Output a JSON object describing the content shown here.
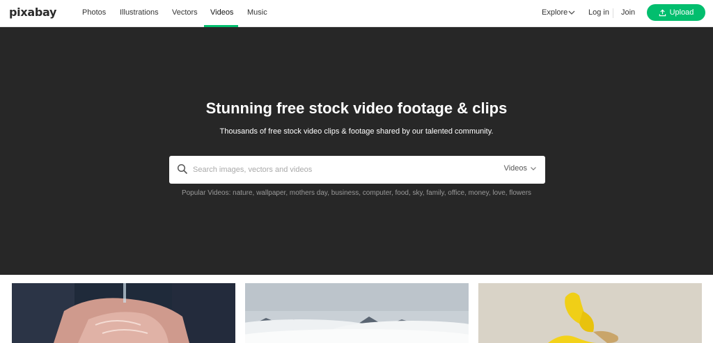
{
  "header": {
    "logo": "pixabay",
    "nav": [
      {
        "label": "Photos"
      },
      {
        "label": "Illustrations"
      },
      {
        "label": "Vectors"
      },
      {
        "label": "Videos",
        "active": true
      },
      {
        "label": "Music"
      }
    ],
    "explore_label": "Explore",
    "login_label": "Log in",
    "join_label": "Join",
    "upload_label": "Upload"
  },
  "hero": {
    "title": "Stunning free stock video footage & clips",
    "subtitle": "Thousands of free stock video clips & footage shared by our talented community."
  },
  "search": {
    "placeholder": "Search images, vectors and videos",
    "type_label": "Videos"
  },
  "popular": {
    "label": "Popular Videos:",
    "tags": [
      "nature",
      "wallpaper",
      "mothers day",
      "business",
      "computer",
      "food",
      "sky",
      "family",
      "office",
      "money",
      "love",
      "flowers"
    ]
  },
  "thumbnails": [
    {
      "subject": "hands washing"
    },
    {
      "subject": "mountains above clouds"
    },
    {
      "subject": "yellow flower"
    }
  ],
  "colors": {
    "accent": "#02be6e",
    "hero_bg": "#272727"
  },
  "icons": [
    "search-icon",
    "chevron-down-icon",
    "upload-icon"
  ]
}
